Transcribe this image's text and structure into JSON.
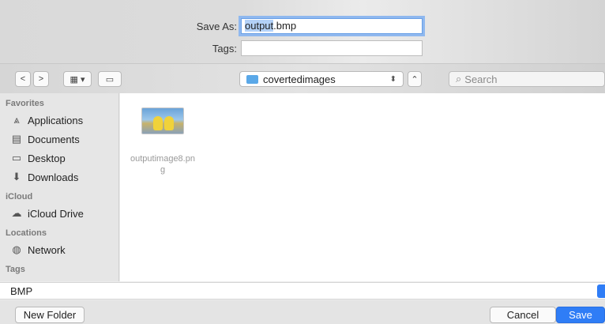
{
  "save_as": {
    "label": "Save As:",
    "value_selected": "output",
    "value_rest": ".bmp"
  },
  "tags": {
    "label": "Tags:",
    "value": ""
  },
  "toolbar": {
    "back": "<",
    "forward": ">",
    "view_icon": "grid-view-icon",
    "location": "covertedimages",
    "search_placeholder": "Search"
  },
  "sidebar": {
    "favorites_title": "Favorites",
    "favorites": [
      {
        "label": "Applications",
        "icon": "applications-icon"
      },
      {
        "label": "Documents",
        "icon": "documents-icon"
      },
      {
        "label": "Desktop",
        "icon": "desktop-icon"
      },
      {
        "label": "Downloads",
        "icon": "downloads-icon"
      }
    ],
    "icloud_title": "iCloud",
    "icloud": [
      {
        "label": "iCloud Drive",
        "icon": "cloud-icon"
      }
    ],
    "locations_title": "Locations",
    "locations": [
      {
        "label": "Network",
        "icon": "network-icon"
      }
    ],
    "tags_title": "Tags"
  },
  "file": {
    "name": "outputimage8.png"
  },
  "format": {
    "value": "BMP"
  },
  "buttons": {
    "new_folder": "New Folder",
    "cancel": "Cancel",
    "save": "Save"
  },
  "colors": {
    "accent": "#2f7df6",
    "focus_ring": "#8fb8ef"
  }
}
